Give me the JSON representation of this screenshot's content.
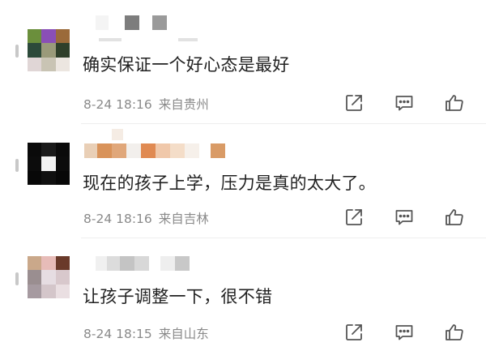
{
  "comments": [
    {
      "text": "确实保证一个好心态是最好",
      "date": "8-24 18:16",
      "location": "来自贵州"
    },
    {
      "text": "现在的孩子上学，压力是真的太大了。",
      "date": "8-24 18:16",
      "location": "来自吉林"
    },
    {
      "text": "让孩子调整一下，很不错",
      "date": "8-24 18:15",
      "location": "来自山东"
    }
  ],
  "icons": {
    "share": "share-icon",
    "comment": "comment-icon",
    "like": "like-icon"
  },
  "colors": {
    "text": "#222222",
    "meta": "#8a8a8a",
    "icon": "#555555"
  }
}
